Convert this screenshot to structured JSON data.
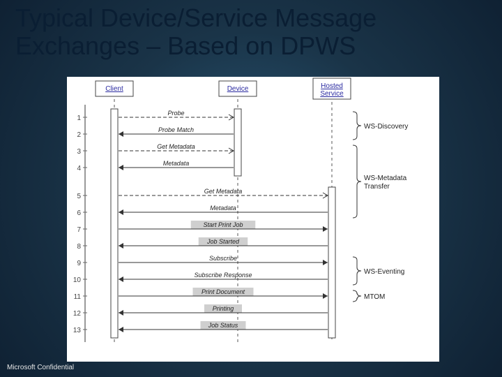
{
  "title": "Typical Device/Service Message Exchanges – Based on DPWS",
  "footer": "Microsoft Confidential",
  "actors": {
    "client": "Client",
    "device": "Device",
    "hosted": "Hosted\nService"
  },
  "messages": [
    {
      "n": "1",
      "label": "Probe",
      "from": "client",
      "to": "device",
      "dashed": true,
      "shaded": false
    },
    {
      "n": "2",
      "label": "Probe Match",
      "from": "device",
      "to": "client",
      "dashed": false,
      "shaded": false
    },
    {
      "n": "3",
      "label": "Get Metadata",
      "from": "client",
      "to": "device",
      "dashed": true,
      "shaded": false
    },
    {
      "n": "4",
      "label": "Metadata",
      "from": "device",
      "to": "client",
      "dashed": false,
      "shaded": false
    },
    {
      "n": "5",
      "label": "Get Metadata",
      "from": "client",
      "to": "hosted",
      "dashed": true,
      "shaded": false
    },
    {
      "n": "6",
      "label": "Metadata",
      "from": "hosted",
      "to": "client",
      "dashed": false,
      "shaded": false
    },
    {
      "n": "7",
      "label": "Start Print Job",
      "from": "client",
      "to": "hosted",
      "dashed": false,
      "shaded": true
    },
    {
      "n": "8",
      "label": "Job Started",
      "from": "hosted",
      "to": "client",
      "dashed": false,
      "shaded": true
    },
    {
      "n": "9",
      "label": "Subscribe",
      "from": "client",
      "to": "hosted",
      "dashed": false,
      "shaded": false
    },
    {
      "n": "10",
      "label": "Subscribe Response",
      "from": "hosted",
      "to": "client",
      "dashed": false,
      "shaded": false
    },
    {
      "n": "11",
      "label": "Print Document",
      "from": "client",
      "to": "hosted",
      "dashed": false,
      "shaded": true
    },
    {
      "n": "12",
      "label": "Printing",
      "from": "hosted",
      "to": "client",
      "dashed": false,
      "shaded": true
    },
    {
      "n": "13",
      "label": "Job Status",
      "from": "hosted",
      "to": "client",
      "dashed": false,
      "shaded": true
    }
  ],
  "groups": [
    {
      "label": "WS-Discovery",
      "rows": [
        1,
        2
      ]
    },
    {
      "label": "WS-Metadata\nTransfer",
      "rows": [
        3,
        6
      ]
    },
    {
      "label": "WS-Eventing",
      "rows": [
        9,
        10
      ]
    },
    {
      "label": "MTOM",
      "rows": [
        11,
        11
      ]
    }
  ],
  "chart_data": {
    "type": "sequence-diagram",
    "lifelines": [
      "Client",
      "Device",
      "Hosted Service"
    ],
    "interactions": [
      {
        "seq": 1,
        "from": "Client",
        "to": "Device",
        "message": "Probe",
        "style": "dashed",
        "spec": "WS-Discovery"
      },
      {
        "seq": 2,
        "from": "Device",
        "to": "Client",
        "message": "Probe Match",
        "style": "solid",
        "spec": "WS-Discovery"
      },
      {
        "seq": 3,
        "from": "Client",
        "to": "Device",
        "message": "Get Metadata",
        "style": "dashed",
        "spec": "WS-Metadata Transfer"
      },
      {
        "seq": 4,
        "from": "Device",
        "to": "Client",
        "message": "Metadata",
        "style": "solid",
        "spec": "WS-Metadata Transfer"
      },
      {
        "seq": 5,
        "from": "Client",
        "to": "Hosted Service",
        "message": "Get Metadata",
        "style": "dashed",
        "spec": "WS-Metadata Transfer"
      },
      {
        "seq": 6,
        "from": "Hosted Service",
        "to": "Client",
        "message": "Metadata",
        "style": "solid",
        "spec": "WS-Metadata Transfer"
      },
      {
        "seq": 7,
        "from": "Client",
        "to": "Hosted Service",
        "message": "Start Print Job",
        "style": "solid",
        "spec": null
      },
      {
        "seq": 8,
        "from": "Hosted Service",
        "to": "Client",
        "message": "Job Started",
        "style": "solid",
        "spec": null
      },
      {
        "seq": 9,
        "from": "Client",
        "to": "Hosted Service",
        "message": "Subscribe",
        "style": "solid",
        "spec": "WS-Eventing"
      },
      {
        "seq": 10,
        "from": "Hosted Service",
        "to": "Client",
        "message": "Subscribe Response",
        "style": "solid",
        "spec": "WS-Eventing"
      },
      {
        "seq": 11,
        "from": "Client",
        "to": "Hosted Service",
        "message": "Print Document",
        "style": "solid",
        "spec": "MTOM"
      },
      {
        "seq": 12,
        "from": "Hosted Service",
        "to": "Client",
        "message": "Printing",
        "style": "solid",
        "spec": null
      },
      {
        "seq": 13,
        "from": "Hosted Service",
        "to": "Client",
        "message": "Job Status",
        "style": "solid",
        "spec": null
      }
    ]
  }
}
